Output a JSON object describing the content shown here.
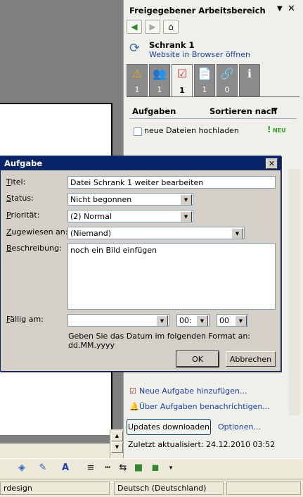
{
  "pane": {
    "title": "Freigegebener Arbeitsbereich",
    "close_glyph": "✕",
    "dropdown_glyph": "▼",
    "nav": {
      "back_icon": "back-arrow-icon",
      "forward_icon": "forward-arrow-icon",
      "home_icon": "home-icon"
    },
    "workspace_name": "Schrank 1",
    "open_in_browser": "Website in Browser öffnen",
    "tabs": [
      {
        "icon": "warning-icon",
        "glyph": "⚠",
        "count": "1"
      },
      {
        "icon": "members-icon",
        "glyph": "👥",
        "count": "1"
      },
      {
        "icon": "tasks-icon",
        "glyph": "☑",
        "count": "1"
      },
      {
        "icon": "documents-icon",
        "glyph": "📄",
        "count": "1"
      },
      {
        "icon": "links-icon",
        "glyph": "🔗",
        "count": "0"
      },
      {
        "icon": "info-icon",
        "glyph": "ℹ",
        "count": ""
      }
    ],
    "active_tab": 2,
    "section_title": "Aufgaben",
    "sort_label": "Sortieren nach",
    "task": {
      "label": "neue Dateien hochladen",
      "flag": "!",
      "badge": "NEU"
    },
    "add_task": "Neue Aufgabe hinzufügen...",
    "notify": "Über Aufgaben benachrichtigen...",
    "updates_button": "Updates downloaden",
    "options_link": "Optionen...",
    "last_updated": "Zuletzt aktualisiert: 24.12.2010 03:52"
  },
  "dialog": {
    "title": "Aufgabe",
    "close_glyph": "✕",
    "title_label_rest": "itel:",
    "title_label_acc": "T",
    "title_value": "Datei Schrank 1 weiter bearbeiten",
    "status_label_acc": "S",
    "status_label_rest": "tatus:",
    "status_value": "Nicht begonnen",
    "priority_label_acc": "P",
    "priority_label_rest": "riorität:",
    "priority_value": "(2) Normal",
    "assigned_label_acc": "Z",
    "assigned_label_rest": "ugewiesen an:",
    "assigned_value": "(Niemand)",
    "description_label_acc": "B",
    "description_label_rest": "eschreibung:",
    "description_value": "noch ein Bild einfügen",
    "due_label_acc": "F",
    "due_label_rest": "ällig am:",
    "due_date": "",
    "due_hour": "00:",
    "due_minute": "00",
    "hint": "Geben Sie das Datum im folgenden Format an: dd.MM.yyyy",
    "ok": "OK",
    "cancel": "Abbrechen"
  },
  "statusbar": {
    "left": "rdesign",
    "language": "Deutsch (Deutschland)"
  },
  "toolbar": {
    "icons": [
      "fill-color-icon",
      "line-color-icon",
      "font-color-icon",
      "line-style-icon",
      "dash-style-icon",
      "arrow-style-icon",
      "shadow-icon",
      "3d-icon"
    ]
  }
}
